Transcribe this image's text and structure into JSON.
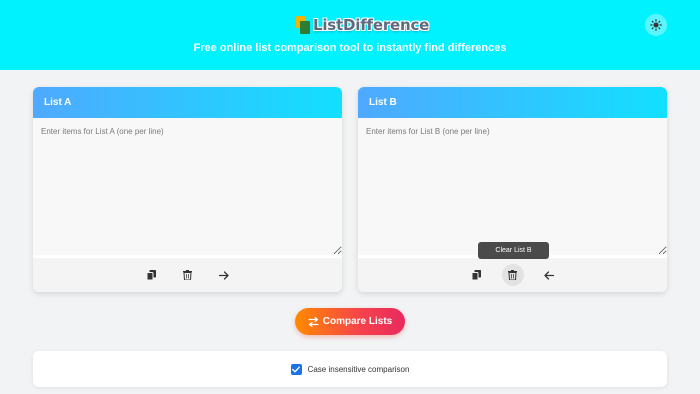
{
  "header": {
    "logo_text": "ListDifference",
    "tagline": "Free online list comparison tool to instantly find differences",
    "theme_icon": "sun-icon",
    "accent_color": "#00f2ff"
  },
  "list_a": {
    "title": "List A",
    "placeholder": "Enter items for List A (one per line)",
    "value": "",
    "tools": [
      "copy-icon",
      "trash-icon",
      "arrow-right-icon"
    ]
  },
  "list_b": {
    "title": "List B",
    "placeholder": "Enter items for List B (one per line)",
    "value": "",
    "tools": [
      "copy-icon",
      "trash-icon",
      "arrow-left-icon"
    ],
    "tooltip": "Clear List B"
  },
  "compare_button": {
    "label": "Compare Lists",
    "icon": "swap-icon"
  },
  "options": {
    "case_insensitive_label": "Case insensitive comparison",
    "case_insensitive_checked": true
  }
}
